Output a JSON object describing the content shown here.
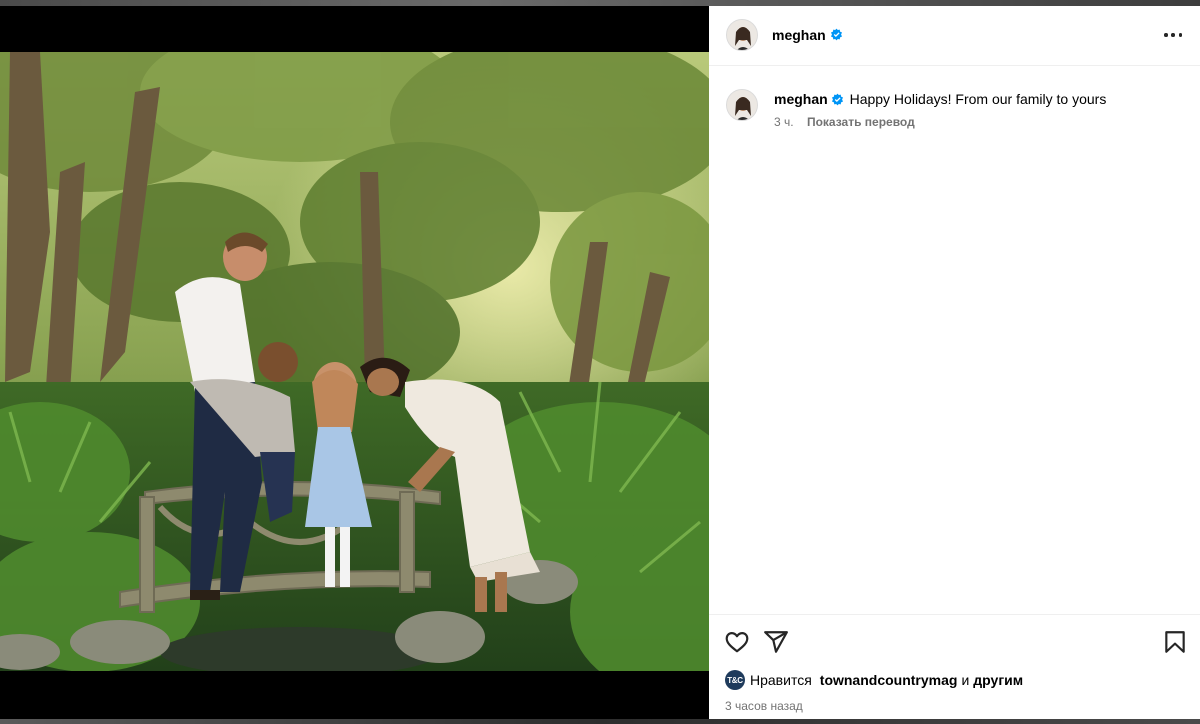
{
  "post": {
    "username": "meghan",
    "caption": "Happy Holidays! From our family to yours",
    "time_short": "3 ч.",
    "translate_link": "Показать перевод",
    "likes_prefix": "Нравится",
    "liked_by": "townandcountrymag",
    "likes_and": "и",
    "likes_others": "другим",
    "liked_by_avatar_text": "T&C",
    "time_long": "3 часов назад"
  },
  "icons": {
    "more": "more-horizontal-icon",
    "verified": "verified-badge-icon",
    "like": "heart-icon",
    "share": "paper-plane-icon",
    "save": "bookmark-icon"
  },
  "colors": {
    "verified": "#0095f6",
    "secondary_text": "#737373",
    "divider": "#efefef"
  }
}
